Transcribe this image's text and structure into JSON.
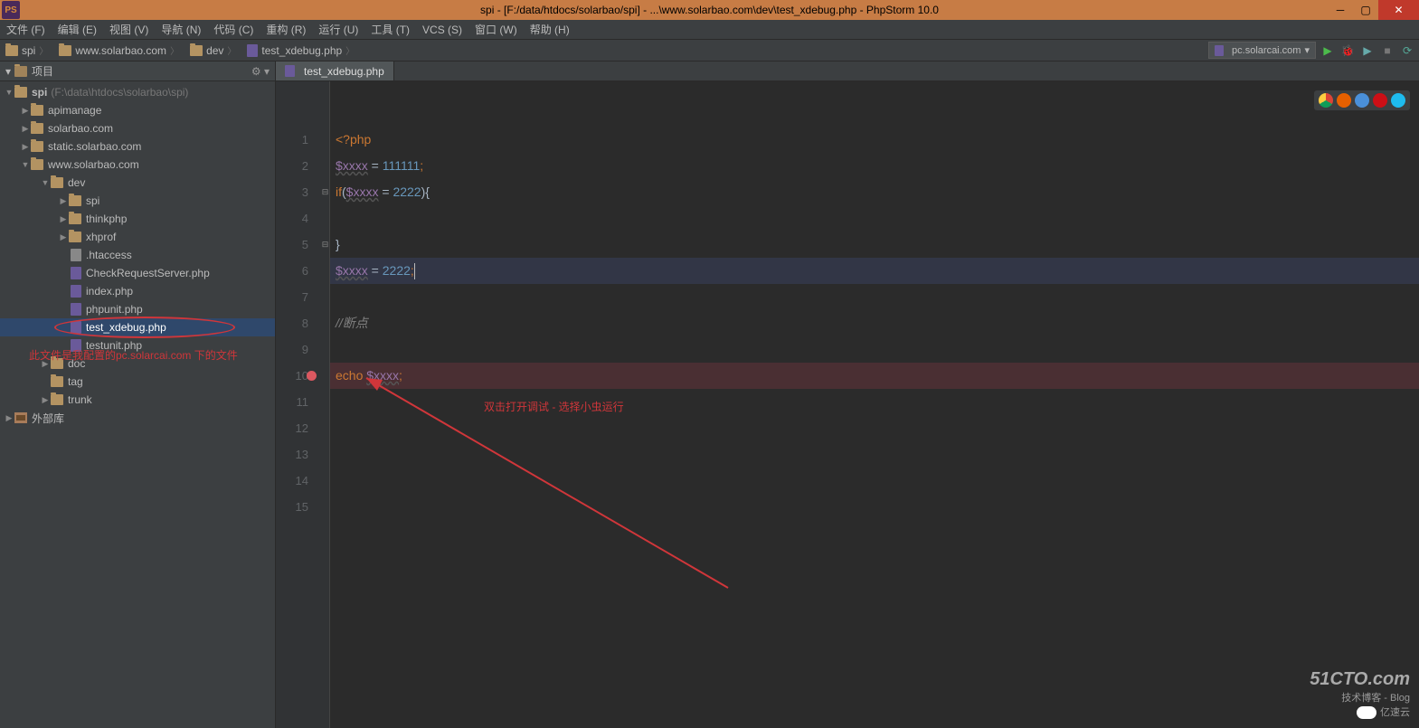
{
  "titlebar": "spi - [F:/data/htdocs/solarbao/spi] - ...\\www.solarbao.com\\dev\\test_xdebug.php - PhpStorm 10.0",
  "menu": [
    "文件 (F)",
    "编辑 (E)",
    "视图 (V)",
    "导航 (N)",
    "代码 (C)",
    "重构 (R)",
    "运行 (U)",
    "工具 (T)",
    "VCS (S)",
    "窗口 (W)",
    "帮助 (H)"
  ],
  "breadcrumbs": [
    {
      "icon": "folder",
      "label": "spi"
    },
    {
      "icon": "folder",
      "label": "www.solarbao.com"
    },
    {
      "icon": "folder",
      "label": "dev"
    },
    {
      "icon": "file",
      "label": "test_xdebug.php"
    }
  ],
  "run_config": "pc.solarcai.com",
  "panel": {
    "title": "项目"
  },
  "tree": {
    "root": {
      "label": "spi",
      "path": "(F:\\data\\htdocs\\solarbao\\spi)"
    },
    "l1": [
      {
        "label": "apimanage"
      },
      {
        "label": "solarbao.com"
      },
      {
        "label": "static.solarbao.com"
      },
      {
        "label": "www.solarbao.com",
        "open": true
      }
    ],
    "dev": {
      "label": "dev"
    },
    "dev_children": [
      {
        "type": "folder",
        "label": "spi"
      },
      {
        "type": "folder",
        "label": "thinkphp"
      },
      {
        "type": "folder",
        "label": "xhprof"
      },
      {
        "type": "txt",
        "label": ".htaccess"
      },
      {
        "type": "php",
        "label": "CheckRequestServer.php"
      },
      {
        "type": "php",
        "label": "index.php"
      },
      {
        "type": "php",
        "label": "phpunit.php"
      },
      {
        "type": "php",
        "label": "test_xdebug.php",
        "selected": true
      },
      {
        "type": "php",
        "label": "testunit.php"
      }
    ],
    "after_dev": [
      {
        "label": "doc"
      },
      {
        "label": "tag"
      },
      {
        "label": "trunk"
      }
    ],
    "lib": "外部库"
  },
  "annotation1": "此文件是我配置的pc.solarcai.com 下的文件",
  "tab": "test_xdebug.php",
  "code": {
    "l1": {
      "tag": "<?php"
    },
    "l2": {
      "var": "$xxxx",
      "op": " = ",
      "num": "111111",
      "semi": ";"
    },
    "l3": {
      "kw": "if",
      "open": "(",
      "var": "$xxxx",
      "op2": " = ",
      "num": "2222",
      "close": ")",
      "brace": "{"
    },
    "l5": {
      "brace": "}"
    },
    "l6": {
      "var": "$xxxx",
      "op": " = ",
      "num": "2222",
      "semi": ";"
    },
    "l8": {
      "comment": "//断点"
    },
    "l10": {
      "echo": "echo ",
      "var": "$xxxx",
      "semi": ";"
    }
  },
  "annotation2": "双击打开调试 - 选择小虫运行",
  "watermark": {
    "big": "51CTO.com",
    "mid": "技术博客 - Blog",
    "small": "亿速云"
  }
}
